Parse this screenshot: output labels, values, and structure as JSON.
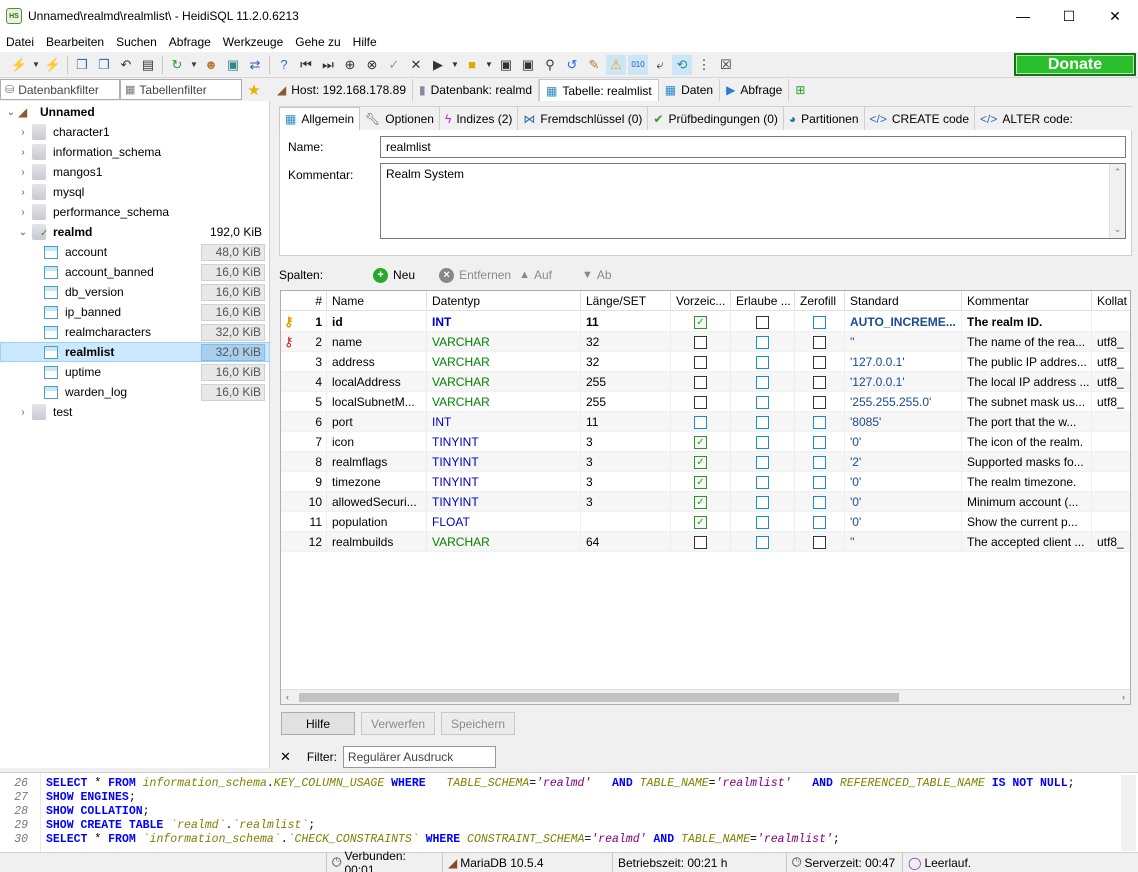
{
  "window": {
    "title": "Unnamed\\realmd\\realmlist\\ - HeidiSQL 11.2.0.6213",
    "app_icon_text": "HS",
    "minimize": "—",
    "maximize": "☐",
    "close": "✕"
  },
  "menu": [
    "Datei",
    "Bearbeiten",
    "Suchen",
    "Abfrage",
    "Werkzeuge",
    "Gehe zu",
    "Hilfe"
  ],
  "toolbar": {
    "donate_label": "Donate"
  },
  "left_filters": {
    "db_filter_placeholder": "Datenbankfilter",
    "table_filter_placeholder": "Tabellenfilter"
  },
  "tree": {
    "root": "Unnamed",
    "databases": [
      "character1",
      "information_schema",
      "mangos1",
      "mysql",
      "performance_schema"
    ],
    "realmd": {
      "name": "realmd",
      "size": "192,0 KiB"
    },
    "tables": [
      {
        "name": "account",
        "size": "48,0 KiB"
      },
      {
        "name": "account_banned",
        "size": "16,0 KiB"
      },
      {
        "name": "db_version",
        "size": "16,0 KiB"
      },
      {
        "name": "ip_banned",
        "size": "16,0 KiB"
      },
      {
        "name": "realmcharacters",
        "size": "32,0 KiB"
      },
      {
        "name": "realmlist",
        "size": "32,0 KiB"
      },
      {
        "name": "uptime",
        "size": "16,0 KiB"
      },
      {
        "name": "warden_log",
        "size": "16,0 KiB"
      }
    ],
    "after": "test"
  },
  "main_tabs": {
    "host": "Host: 192.168.178.89",
    "database": "Datenbank: realmd",
    "table": "Tabelle: realmlist",
    "data": "Daten",
    "query": "Abfrage"
  },
  "sub_tabs": {
    "general": "Allgemein",
    "options": "Optionen",
    "indexes": "Indizes (2)",
    "foreign_keys": "Fremdschlüssel (0)",
    "checks": "Prüfbedingungen (0)",
    "partitions": "Partitionen",
    "create_code": "CREATE code",
    "alter_code": "ALTER code:"
  },
  "form": {
    "name_label": "Name:",
    "name_value": "realmlist",
    "comment_label": "Kommentar:",
    "comment_value": "Realm System"
  },
  "columns_bar": {
    "label": "Spalten:",
    "new": "Neu",
    "remove": "Entfernen",
    "up": "Auf",
    "down": "Ab"
  },
  "grid": {
    "headers": [
      "#",
      "Name",
      "Datentyp",
      "Länge/SET",
      "Vorzeic...",
      "Erlaube ...",
      "Zerofill",
      "Standard",
      "Kommentar",
      "Kollat"
    ],
    "rows": [
      {
        "n": "1",
        "name": "id",
        "type": "INT",
        "len": "11",
        "unsigned": true,
        "nullable": false,
        "zerofill": false,
        "default": "AUTO_INCREME...",
        "comment": "The realm ID.",
        "coll": "",
        "key": "primary",
        "bold": true
      },
      {
        "n": "2",
        "name": "name",
        "type": "VARCHAR",
        "len": "32",
        "unsigned": false,
        "nullable": false,
        "zerofill": false,
        "default": "''",
        "comment": "The name of the rea...",
        "coll": "utf8_",
        "key": "unique",
        "bold": false
      },
      {
        "n": "3",
        "name": "address",
        "type": "VARCHAR",
        "len": "32",
        "unsigned": false,
        "nullable": false,
        "zerofill": false,
        "default": "'127.0.0.1'",
        "comment": "The public IP addres...",
        "coll": "utf8_",
        "key": "",
        "bold": false
      },
      {
        "n": "4",
        "name": "localAddress",
        "type": "VARCHAR",
        "len": "255",
        "unsigned": false,
        "nullable": false,
        "zerofill": false,
        "default": "'127.0.0.1'",
        "comment": "The local IP address ...",
        "coll": "utf8_",
        "key": "",
        "bold": false
      },
      {
        "n": "5",
        "name": "localSubnetM...",
        "type": "VARCHAR",
        "len": "255",
        "unsigned": false,
        "nullable": false,
        "zerofill": false,
        "default": "'255.255.255.0'",
        "comment": "The subnet mask us...",
        "coll": "utf8_",
        "key": "",
        "bold": false
      },
      {
        "n": "6",
        "name": "port",
        "type": "INT",
        "len": "11",
        "unsigned": false,
        "nullable": false,
        "zerofill": false,
        "default": "'8085'",
        "comment": "The port that the w...",
        "coll": "",
        "key": "",
        "bold": false
      },
      {
        "n": "7",
        "name": "icon",
        "type": "TINYINT",
        "len": "3",
        "unsigned": true,
        "nullable": false,
        "zerofill": false,
        "default": "'0'",
        "comment": "The icon of the realm.",
        "coll": "",
        "key": "",
        "bold": false
      },
      {
        "n": "8",
        "name": "realmflags",
        "type": "TINYINT",
        "len": "3",
        "unsigned": true,
        "nullable": false,
        "zerofill": false,
        "default": "'2'",
        "comment": "Supported masks fo...",
        "coll": "",
        "key": "",
        "bold": false
      },
      {
        "n": "9",
        "name": "timezone",
        "type": "TINYINT",
        "len": "3",
        "unsigned": true,
        "nullable": false,
        "zerofill": false,
        "default": "'0'",
        "comment": "The realm timezone.",
        "coll": "",
        "key": "",
        "bold": false
      },
      {
        "n": "10",
        "name": "allowedSecuri...",
        "type": "TINYINT",
        "len": "3",
        "unsigned": true,
        "nullable": false,
        "zerofill": false,
        "default": "'0'",
        "comment": "Minimum account (...",
        "coll": "",
        "key": "",
        "bold": false
      },
      {
        "n": "11",
        "name": "population",
        "type": "FLOAT",
        "len": "",
        "unsigned": true,
        "nullable": false,
        "zerofill": false,
        "default": "'0'",
        "comment": "Show the current p...",
        "coll": "",
        "key": "",
        "bold": false
      },
      {
        "n": "12",
        "name": "realmbuilds",
        "type": "VARCHAR",
        "len": "64",
        "unsigned": false,
        "nullable": false,
        "zerofill": false,
        "default": "''",
        "comment": "The accepted client ...",
        "coll": "utf8_",
        "key": "",
        "bold": false
      }
    ]
  },
  "buttons": {
    "help": "Hilfe",
    "discard": "Verwerfen",
    "save": "Speichern"
  },
  "bottom_filter": {
    "label": "Filter:",
    "placeholder": "Regulärer Ausdruck",
    "close": "✕"
  },
  "sql_log": [
    {
      "ln": "26"
    },
    {
      "ln": "27"
    },
    {
      "ln": "28"
    },
    {
      "ln": "29"
    },
    {
      "ln": "30"
    }
  ],
  "status": {
    "connected": "Verbunden: 00:01",
    "server": "MariaDB 10.5.4",
    "uptime": "Betriebszeit: 00:21 h",
    "server_time": "Serverzeit: 00:47",
    "idle": "Leerlauf."
  },
  "colors": {
    "type_int": "#0000c0",
    "type_string": "#008000",
    "donate": "#2bc02b",
    "selection": "#cce8ff"
  }
}
